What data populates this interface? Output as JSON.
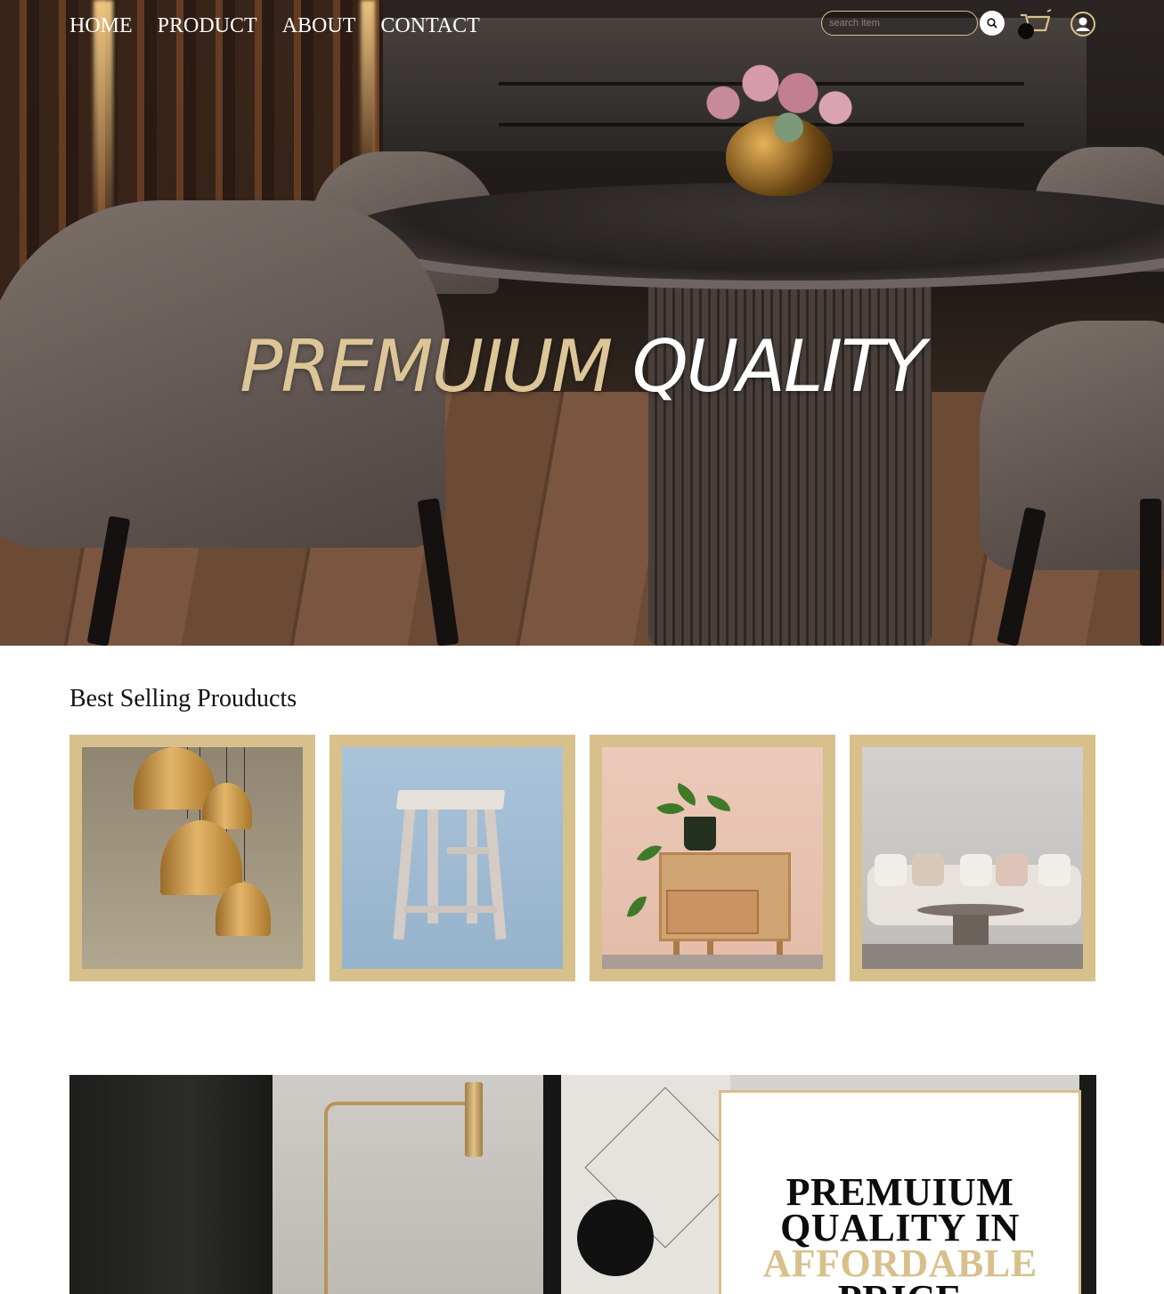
{
  "nav": {
    "items": [
      "HOME",
      "PRODUCT",
      "ABOUT",
      "CONTACT"
    ]
  },
  "search": {
    "placeholder": "search item"
  },
  "icons": {
    "search": "search-icon",
    "cart": "cart-icon",
    "user": "user-icon"
  },
  "hero": {
    "title_part1": "PREMUIUM",
    "title_part2": "QUALITY"
  },
  "best_selling": {
    "title": "Best Selling Prouducts",
    "products": [
      {
        "image": "pendant-lamps"
      },
      {
        "image": "wooden-stool"
      },
      {
        "image": "nightstand-with-plant"
      },
      {
        "image": "sofa-living-room"
      }
    ]
  },
  "promo": {
    "line1": "PREMUIUM",
    "line2": "QUALITY IN",
    "line3": "AFFORDABLE",
    "line4": "PRICE"
  },
  "colors": {
    "accent_gold": "#d8c08c",
    "hero_gold": "#dcc597",
    "text_dark": "#111111",
    "white": "#ffffff"
  }
}
